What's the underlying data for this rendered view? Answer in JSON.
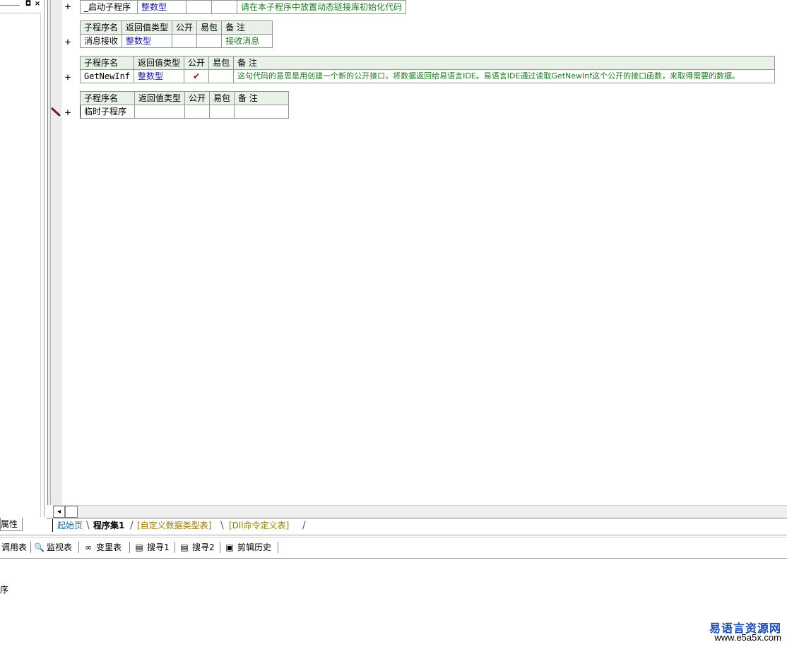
{
  "left_panel": {
    "pin_icon": "◘",
    "close_icon": "×",
    "tab_label": "属性"
  },
  "editor": {
    "header": {
      "name": "子程序名",
      "ret": "返回值类型",
      "public": "公开",
      "easypkg": "易包",
      "remark": "备 注"
    },
    "subroutines": [
      {
        "name": "_启动子程序",
        "ret": "整数型",
        "public": "",
        "easypkg": "",
        "remark": "请在本子程序中放置动态链接库初始化代码",
        "expand": "+"
      },
      {
        "name": "消息接收",
        "ret": "整数型",
        "public": "",
        "easypkg": "",
        "remark": "接收消息",
        "expand": "+"
      },
      {
        "name": "GetNewInf",
        "ret": "整数型",
        "public": "✔",
        "easypkg": "",
        "remark": "这句代码的意思是用创建一个新的公开接口，将数据返回给易语言IDE。易语言IDE通过读取GetNewInf这个公开的接口函数，来取得需要的数据。",
        "expand": "+"
      },
      {
        "name": "临时子程序",
        "ret": "",
        "public": "",
        "easypkg": "",
        "remark": "",
        "expand": "+"
      }
    ]
  },
  "scroll": {
    "left_arrow": "◂"
  },
  "tabs": [
    "起始页",
    "程序集1",
    "[自定义数据类型表]",
    "[Dll命令定义表]"
  ],
  "toolbar": {
    "items": [
      {
        "label": "调用表",
        "icon": ""
      },
      {
        "label": "监视表",
        "icon": "🔍"
      },
      {
        "label": "变里表",
        "icon": "∞"
      },
      {
        "label": "搜寻1",
        "icon": "▤"
      },
      {
        "label": "搜寻2",
        "icon": "▤"
      },
      {
        "label": "剪辑历史",
        "icon": "▣"
      }
    ]
  },
  "output": {
    "text": "序"
  },
  "watermark": {
    "title": "易语言资源网",
    "url": "www.e5a5x.com"
  },
  "colors": {
    "type": "#1a1aa0",
    "remark": "#1e7a1e",
    "header_bg": "#e8f0e8",
    "check": "#b00000",
    "tab_link": "#1a6aa0",
    "tab_yellow": "#9a7a00"
  }
}
